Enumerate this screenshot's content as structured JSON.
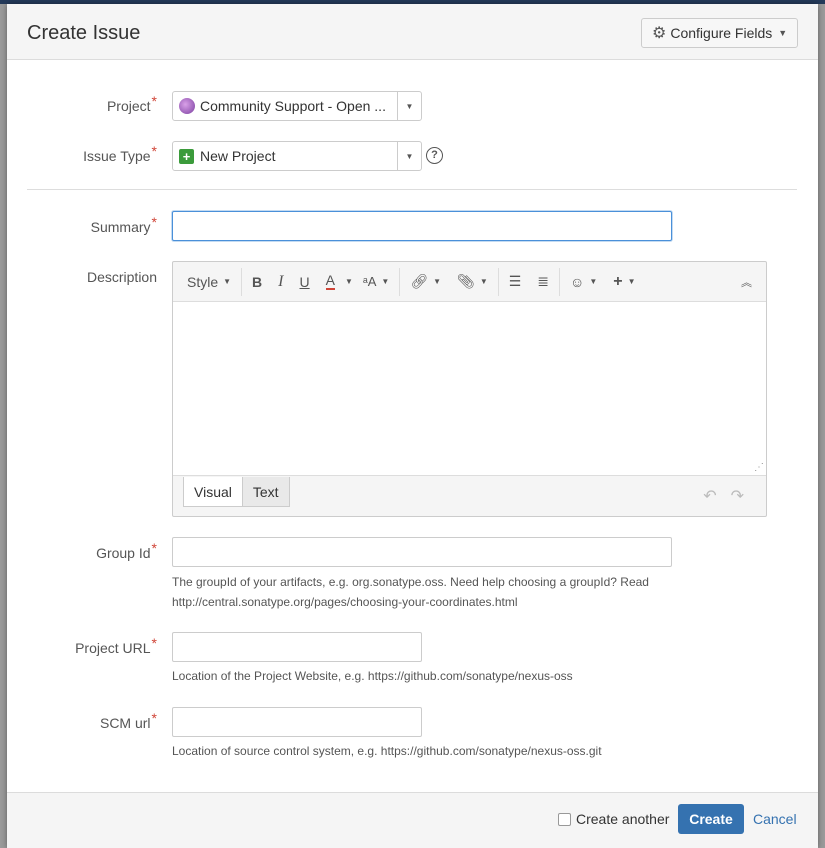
{
  "dialog": {
    "title": "Create Issue",
    "configure_label": "Configure Fields"
  },
  "project": {
    "label": "Project",
    "value": "Community Support - Open ..."
  },
  "issue_type": {
    "label": "Issue Type",
    "value": "New Project"
  },
  "summary": {
    "label": "Summary",
    "value": ""
  },
  "description": {
    "label": "Description",
    "toolbar": {
      "style_label": "Style",
      "bold": "B",
      "italic": "I",
      "underline": "U",
      "text_color": "A"
    },
    "tabs": [
      "Visual",
      "Text"
    ]
  },
  "group_id": {
    "label": "Group Id",
    "value": "",
    "hint_line1": "The groupId of your artifacts, e.g. org.sonatype.oss. Need help choosing a groupId? Read",
    "hint_line2": "http://central.sonatype.org/pages/choosing-your-coordinates.html"
  },
  "project_url": {
    "label": "Project URL",
    "value": "",
    "hint": "Location of the Project Website, e.g. https://github.com/sonatype/nexus-oss"
  },
  "scm_url": {
    "label": "SCM url",
    "value": "",
    "hint": "Location of source control system, e.g. https://github.com/sonatype/nexus-oss.git"
  },
  "footer": {
    "create_another_label": "Create another",
    "create_label": "Create",
    "cancel_label": "Cancel"
  },
  "required_mark": "*",
  "colors": {
    "primary": "#3572b0",
    "required": "#d04437",
    "focus": "#4a90d9"
  }
}
